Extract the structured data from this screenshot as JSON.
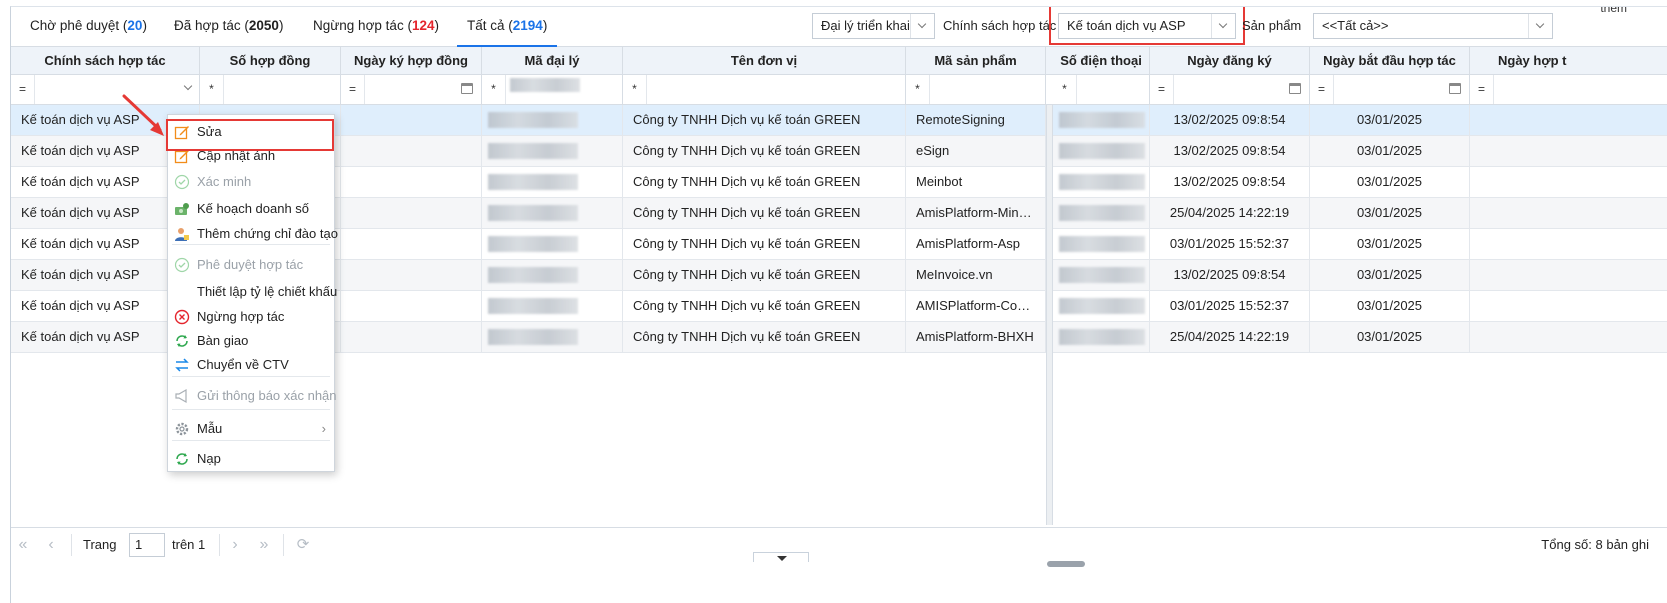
{
  "tabs": [
    {
      "label": "Chờ phê duyệt",
      "count": "20",
      "count_color": "blue"
    },
    {
      "label": "Đã hợp tác",
      "count": "2050",
      "count_color": "none"
    },
    {
      "label": "Ngừng hợp tác",
      "count": "124",
      "count_color": "red"
    },
    {
      "label": "Tất cả",
      "count": "2194",
      "count_color": "blue",
      "active": true
    }
  ],
  "filters": {
    "agent_type": "Đại lý triển khai",
    "policy_label": "Chính sách hợp tác",
    "policy_value": "Kế toán dịch vụ ASP",
    "product_label": "Sản phẩm",
    "product_value": "<<Tất cả>>",
    "cut_text": "thêm"
  },
  "columns": [
    "Chính sách hợp tác",
    "Số hợp đồng",
    "Ngày ký hợp đồng",
    "Mã đại lý",
    "Tên đơn vị",
    "Mã sản phẩm",
    "Số điện thoại",
    "Ngày đăng ký",
    "Ngày bắt đầu hợp tác",
    "Ngày hợp t"
  ],
  "filter_ops": [
    "=",
    "*",
    "=",
    "*",
    "*",
    "*",
    "*",
    "=",
    "=",
    "="
  ],
  "rows": [
    {
      "policy": "Kế toán dịch vụ ASP",
      "unit": "Công ty TNHH Dịch vụ kế toán GREEN",
      "product": "RemoteSigning",
      "reg_date": "13/02/2025 09:8:54",
      "start_date": "03/01/2025"
    },
    {
      "policy": "Kế toán dịch vụ ASP",
      "unit": "Công ty TNHH Dịch vụ kế toán GREEN",
      "product": "eSign",
      "reg_date": "13/02/2025 09:8:54",
      "start_date": "03/01/2025"
    },
    {
      "policy": "Kế toán dịch vụ ASP",
      "unit": "Công ty TNHH Dịch vụ kế toán GREEN",
      "product": "Meinbot",
      "reg_date": "13/02/2025 09:8:54",
      "start_date": "03/01/2025"
    },
    {
      "policy": "Kế toán dịch vụ ASP",
      "unit": "Công ty TNHH Dịch vụ kế toán GREEN",
      "product": "AmisPlatform-MinTax",
      "reg_date": "25/04/2025 14:22:19",
      "start_date": "03/01/2025"
    },
    {
      "policy": "Kế toán dịch vụ ASP",
      "unit": "Công ty TNHH Dịch vụ kế toán GREEN",
      "product": "AmisPlatform-Asp",
      "reg_date": "03/01/2025 15:52:37",
      "start_date": "03/01/2025"
    },
    {
      "policy": "Kế toán dịch vụ ASP",
      "unit": "Công ty TNHH Dịch vụ kế toán GREEN",
      "product": "MeInvoice.vn",
      "reg_date": "13/02/2025 09:8:54",
      "start_date": "03/01/2025"
    },
    {
      "policy": "Kế toán dịch vụ ASP",
      "unit": "Công ty TNHH Dịch vụ kế toán GREEN",
      "product": "AMISPlatform-Com…",
      "reg_date": "03/01/2025 15:52:37",
      "start_date": "03/01/2025"
    },
    {
      "policy": "Kế toán dịch vụ ASP",
      "unit": "Công ty TNHH Dịch vụ kế toán GREEN",
      "product": "AmisPlatform-BHXH",
      "reg_date": "25/04/2025 14:22:19",
      "start_date": "03/01/2025"
    }
  ],
  "context_menu": [
    {
      "label": "Sửa",
      "icon": "edit-icon",
      "disabled": false
    },
    {
      "label": "Cập nhật ảnh",
      "icon": "edit-image-icon",
      "disabled": false
    },
    {
      "label": "Xác minh",
      "icon": "check-circle-icon",
      "disabled": true
    },
    {
      "label": "Kế hoạch doanh số",
      "icon": "money-plan-icon",
      "disabled": false
    },
    {
      "label": "Thêm chứng chỉ đào tạo",
      "icon": "user-certificate-icon",
      "disabled": false
    },
    {
      "label": "Phê duyệt hợp tác",
      "icon": "check-circle-icon",
      "disabled": true
    },
    {
      "label": "Thiết lập tỷ lệ chiết khấu",
      "icon": "",
      "disabled": false
    },
    {
      "label": "Ngừng hợp tác",
      "icon": "stop-circle-icon",
      "disabled": false
    },
    {
      "label": "Bàn giao",
      "icon": "refresh-icon",
      "disabled": false
    },
    {
      "label": "Chuyển về CTV",
      "icon": "transfer-icon",
      "disabled": false
    },
    {
      "label": "Gửi thông báo xác nhận",
      "icon": "megaphone-icon",
      "disabled": true
    },
    {
      "label": "Mẫu",
      "icon": "gear-icon",
      "disabled": false,
      "submenu": true
    },
    {
      "label": "Nạp",
      "icon": "reload-icon",
      "disabled": false
    }
  ],
  "pager": {
    "page_label": "Trang",
    "page_value": "1",
    "of_label": "trên 1",
    "total_text": "Tổng số: 8 bản ghi"
  },
  "colors": {
    "accent": "#1a73e8",
    "count_red": "#e4252d",
    "highlight": "#e53935",
    "selected_row": "#dfeefc",
    "header_bg": "#eef3f9"
  }
}
